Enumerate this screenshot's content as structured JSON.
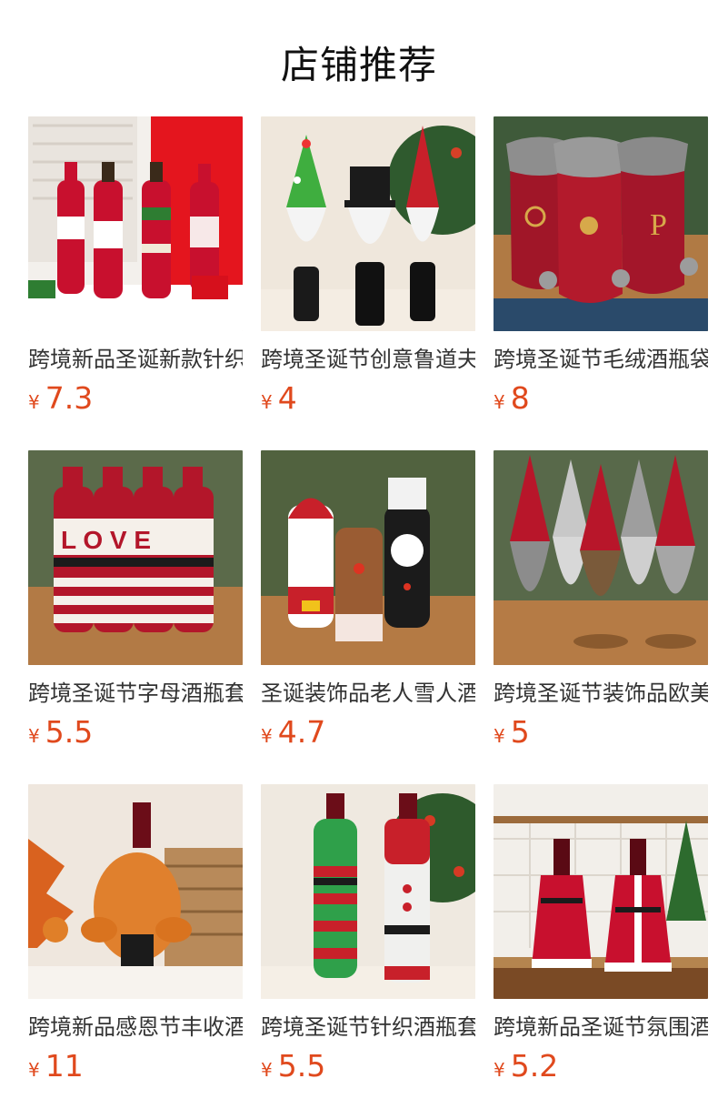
{
  "section": {
    "title": "店铺推荐"
  },
  "currency_symbol": "¥",
  "products": [
    {
      "name": "跨境新品圣诞新款针织酒瓶套",
      "price": "7.3",
      "image_icon": "knitted-wine-bottle-covers-image"
    },
    {
      "name": "跨境圣诞节创意鲁道夫酒瓶套",
      "price": "4",
      "image_icon": "gnome-wine-bottle-covers-image"
    },
    {
      "name": "跨境圣诞节毛绒酒瓶袋",
      "price": "8",
      "image_icon": "velvet-wine-bottle-bags-image"
    },
    {
      "name": "跨境圣诞节字母酒瓶套",
      "price": "5.5",
      "image_icon": "love-letter-bottle-covers-image"
    },
    {
      "name": "圣诞装饰品老人雪人酒瓶套",
      "price": "4.7",
      "image_icon": "santa-snowman-bottle-covers-image"
    },
    {
      "name": "跨境圣诞节装饰品欧美",
      "price": "5",
      "image_icon": "gnome-dolls-image"
    },
    {
      "name": "跨境新品感恩节丰收酒瓶套",
      "price": "11",
      "image_icon": "turkey-wine-bottle-cover-image"
    },
    {
      "name": "跨境圣诞节针织酒瓶套",
      "price": "5.5",
      "image_icon": "elf-sweater-bottle-covers-image"
    },
    {
      "name": "跨境新品圣诞节氛围酒瓶套",
      "price": "5.2",
      "image_icon": "santa-dress-bottle-covers-image"
    }
  ]
}
